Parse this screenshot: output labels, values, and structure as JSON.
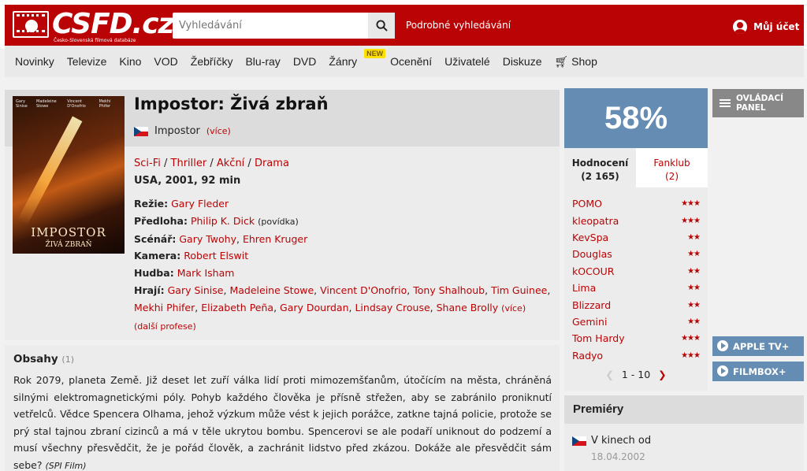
{
  "header": {
    "logo_text": "CSFD.cz",
    "logo_subtitle": "Česko-Slovenská filmová databáze",
    "search_placeholder": "Vyhledávání",
    "advanced_search": "Podrobné vyhledávání",
    "account": "Můj účet"
  },
  "nav": {
    "items": [
      "Novinky",
      "Televize",
      "Kino",
      "VOD",
      "Žebříčky",
      "Blu-ray",
      "DVD",
      "Žánry",
      "Ocenění",
      "Uživatelé",
      "Diskuze",
      "Shop"
    ],
    "new_badge": "NEW"
  },
  "film": {
    "title": "Impostor: Živá zbraň",
    "original_title": "Impostor",
    "original_more": "(více)",
    "genres": [
      "Sci-Fi",
      "Thriller",
      "Akční",
      "Drama"
    ],
    "origin": "USA, 2001, 92 min",
    "poster_title": "IMPOSTOR",
    "poster_subtitle": "ŽIVÁ ZBRAŇ",
    "poster_cast": [
      "Gary Sinise",
      "Madeleine Stowe",
      "Vincent D'Onofrio",
      "Mekhi Phifer"
    ],
    "directing_label": "Režie:",
    "director": "Gary Fleder",
    "source_label": "Předloha:",
    "source": "Philip K. Dick",
    "source_note": "(povídka)",
    "screenplay_label": "Scénář:",
    "screenplay": [
      "Gary Twohy",
      "Ehren Kruger"
    ],
    "camera_label": "Kamera:",
    "camera": "Robert Elswit",
    "music_label": "Hudba:",
    "music": "Mark Isham",
    "cast_label": "Hrají:",
    "cast": [
      "Gary Sinise",
      "Madeleine Stowe",
      "Vincent D'Onofrio",
      "Tony Shalhoub",
      "Tim Guinee",
      "Mekhi Phifer",
      "Elizabeth Peña",
      "Gary Dourdan",
      "Lindsay Crouse",
      "Shane Brolly"
    ],
    "cast_more": "(více)",
    "more_professions": "(další profese)"
  },
  "plot": {
    "heading": "Obsahy",
    "count": "(1)",
    "text": "Rok 2079, planeta Země. Již deset let zuří válka lidí proti mimozemšťanům, útočícím na města, chráněná silnými elektromagnetickými póly. Pohyb každého člověka je přísně střežen, aby se zabránilo proniknutí vetřelců. Vědce Spencera Olhama, jehož výzkum může vést k jejich porážce, zatkne tajná policie, protože se prý stal tajnou zbraní cizinců a má v těle ukrytou bombu. Spencerovi se ale podaří uniknout do podzemí a musí všechny přesvědčit, že je pořád člověk, a zachránit lidstvo před zkázou. Dokáže ale přesvědčit sám sebe?",
    "source": "(SPI Film)"
  },
  "rating": {
    "percent": "58%",
    "tab_ratings": "Hodnocení",
    "tab_ratings_count": "(2 165)",
    "tab_fanclub": "Fanklub",
    "tab_fanclub_count": "(2)",
    "users": [
      {
        "name": "POMO",
        "stars": 3
      },
      {
        "name": "kleopatra",
        "stars": 3
      },
      {
        "name": "KevSpa",
        "stars": 2
      },
      {
        "name": "Douglas",
        "stars": 2
      },
      {
        "name": "kOCOUR",
        "stars": 2
      },
      {
        "name": "Lima",
        "stars": 2
      },
      {
        "name": "Blizzard",
        "stars": 2
      },
      {
        "name": "Gemini",
        "stars": 2
      },
      {
        "name": "Tom Hardy",
        "stars": 3
      },
      {
        "name": "Radyo",
        "stars": 3
      }
    ],
    "pager": "1 - 10"
  },
  "side": {
    "panel": "OVLÁDACÍ PANEL",
    "apple_tv": "APPLE TV+",
    "filmbox": "FILMBOX+"
  },
  "premiery": {
    "heading": "Premiéry",
    "item": "V kinech od",
    "date": "18.04.2002"
  },
  "colors": {
    "brand_red": "#ba0305",
    "rating_blue": "#658db4"
  }
}
